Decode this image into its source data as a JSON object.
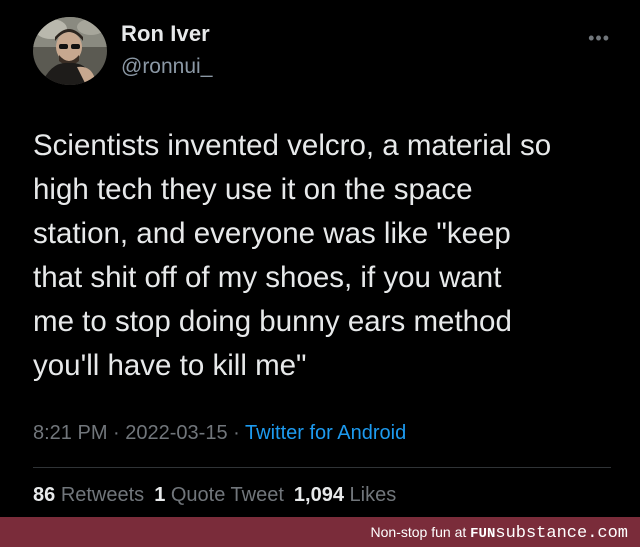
{
  "author": {
    "display_name": "Ron Iver",
    "handle": "@ronnui_",
    "avatar_icon": "user-avatar-photo"
  },
  "more_icon": "more-options-icon",
  "tweet": {
    "text": "Scientists invented velcro, a material so\nhigh tech they use it on the space\nstation, and everyone was like \"keep\nthat shit off of my shoes, if you want\nme to stop doing bunny ears method\nyou'll have to kill me\""
  },
  "meta": {
    "time": "8:21 PM",
    "separator": "·",
    "date": "2022-03-15",
    "source": "Twitter for Android"
  },
  "stats": {
    "retweets_count": "86",
    "retweets_label": "Retweets",
    "quotes_count": "1",
    "quotes_label": "Quote Tweet",
    "likes_count": "1,094",
    "likes_label": "Likes"
  },
  "footer": {
    "text": "Non-stop fun at",
    "brand_a": "FUN",
    "brand_b": "substance.com"
  },
  "colors": {
    "background": "#000000",
    "text": "#e7e9ea",
    "muted": "#71767b",
    "link": "#1d9bf0",
    "footer_bar": "#7a2c3a"
  }
}
